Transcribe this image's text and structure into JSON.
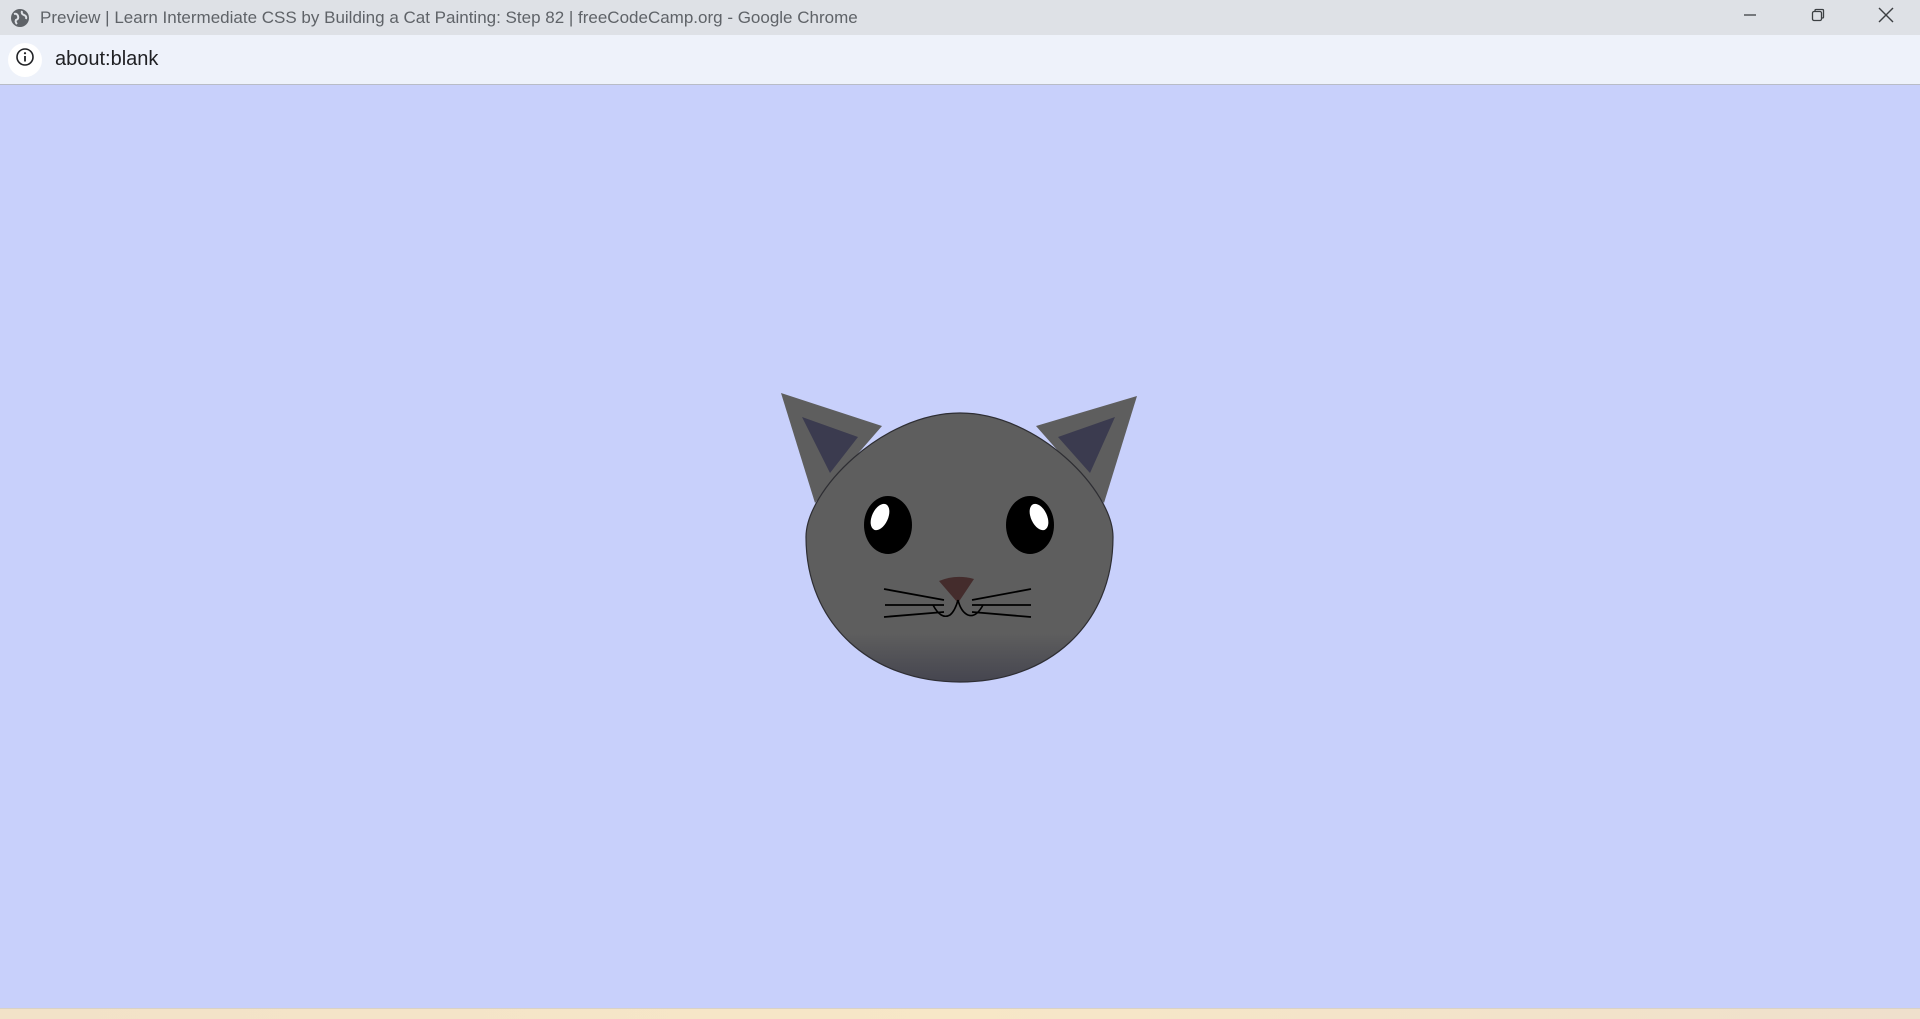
{
  "window": {
    "title": "Preview | Learn Intermediate CSS by Building a Cat Painting: Step 82 | freeCodeCamp.org - Google Chrome",
    "app_icon": "globe-icon",
    "controls": {
      "minimize_icon": "minimize-icon",
      "restore_icon": "restore-icon",
      "close_icon": "close-icon"
    }
  },
  "address_bar": {
    "site_info_icon": "info-icon",
    "url": "about:blank"
  },
  "page": {
    "background_color": "#c8d0fb",
    "cat": {
      "fur_color": "#5e5e5e",
      "inner_ear_color": "#3b3b4f",
      "eye_color": "#000000",
      "eye_shine_color": "#ffffff",
      "nose_color": "#442c2c",
      "chin_gradient_color": "#3b3b4f"
    }
  }
}
